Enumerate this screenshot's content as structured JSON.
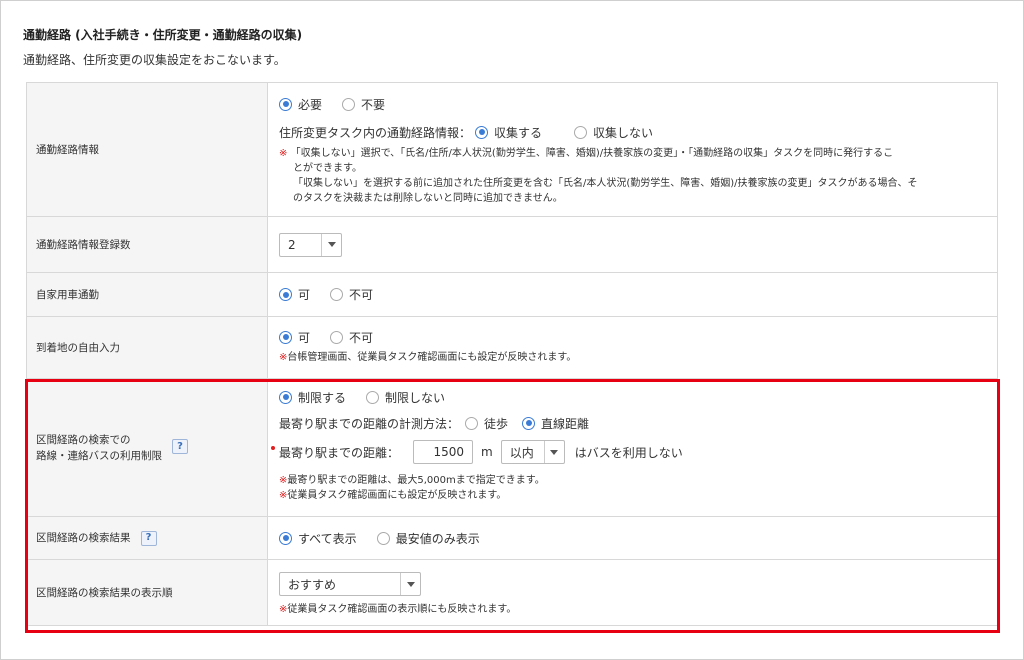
{
  "section": {
    "title": "通勤経路 (入社手続き・住所変更・通勤経路の収集)",
    "description": "通勤経路、住所変更の収集設定をおこないます。"
  },
  "rows": {
    "commute_info": {
      "label": "通勤経路情報",
      "opt_required": "必要",
      "opt_not_required": "不要",
      "collect_label": "住所変更タスク内の通勤経路情報：",
      "opt_collect": "収集する",
      "opt_not_collect": "収集しない",
      "note_mark": "※",
      "note_line1": "「収集しない」選択で、「氏名/住所/本人状況(勤労学生、障害、婚姻)/扶養家族の変更」・「通勤経路の収集」タスクを同時に発行するこ",
      "note_line2": "とができます。",
      "note_line3": "「収集しない」を選択する前に追加された住所変更を含む「氏名/本人状況(勤労学生、障害、婚姻)/扶養家族の変更」タスクがある場合、そ",
      "note_line4": "のタスクを決裁または削除しないと同時に追加できません。"
    },
    "register_count": {
      "label": "通勤経路情報登録数",
      "value": "2"
    },
    "private_car": {
      "label": "自家用車通勤",
      "opt_yes": "可",
      "opt_no": "不可"
    },
    "free_arrival": {
      "label": "到着地の自由入力",
      "opt_yes": "可",
      "opt_no": "不可",
      "note_mark": "※",
      "note": "台帳管理画面、従業員タスク確認画面にも設定が反映されます。"
    },
    "bus_limit": {
      "label_line1": "区間経路の検索での",
      "label_line2": "路線・連絡バスの利用制限",
      "help": "?",
      "opt_limit": "制限する",
      "opt_no_limit": "制限しない",
      "method_label": "最寄り駅までの距離の計測方法：",
      "opt_walk": "徒歩",
      "opt_straight": "直線距離",
      "distance_label": "最寄り駅までの距離：",
      "distance_value": "1500",
      "distance_unit": "m",
      "within_value": "以内",
      "bus_suffix": "はバスを利用しない",
      "note_mark": "※",
      "note1": "最寄り駅までの距離は、最大5,000mまで指定できます。",
      "note2": "従業員タスク確認画面にも設定が反映されます。"
    },
    "search_result": {
      "label": "区間経路の検索結果",
      "help": "?",
      "opt_all": "すべて表示",
      "opt_cheapest": "最安値のみ表示"
    },
    "result_order": {
      "label": "区間経路の検索結果の表示順",
      "value": "おすすめ",
      "note_mark": "※",
      "note": "従業員タスク確認画面の表示順にも反映されます。"
    }
  },
  "colors": {
    "accent": "#3a7bd5",
    "highlight": "#e60012",
    "note_mark": "#e02020"
  }
}
